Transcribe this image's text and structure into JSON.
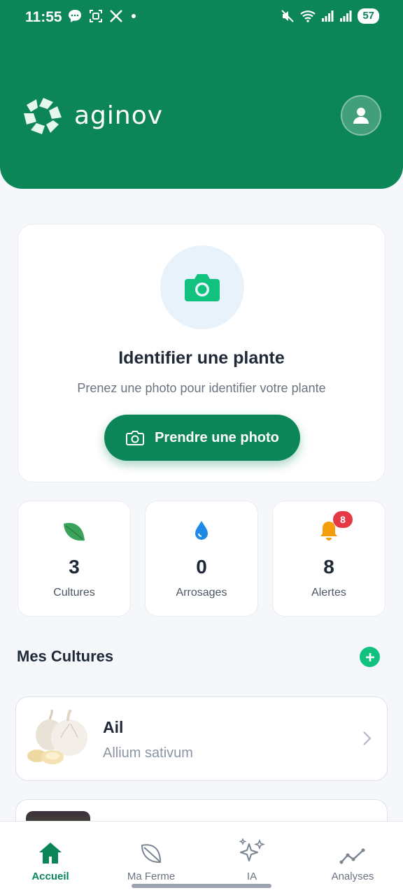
{
  "status_bar": {
    "time": "11:55",
    "battery": "57",
    "icons_left": [
      "chat-bubble-icon",
      "screenshot-icon",
      "x-logo-icon",
      "dot-icon"
    ],
    "icons_right": [
      "mute-icon",
      "wifi-icon",
      "signal-icon",
      "signal-icon"
    ]
  },
  "header": {
    "brand": "aginov",
    "bg_color": "#0c8558"
  },
  "identify": {
    "title": "Identifier une plante",
    "subtitle": "Prenez une photo pour identifier votre plante",
    "button_label": "Prendre une photo"
  },
  "stats": [
    {
      "icon": "leaf-icon",
      "value": "3",
      "label": "Cultures",
      "color": "#3aa35a"
    },
    {
      "icon": "water-drop-icon",
      "value": "0",
      "label": "Arrosages",
      "color": "#1e88e5"
    },
    {
      "icon": "bell-icon",
      "value": "8",
      "label": "Alertes",
      "color": "#f59e0b",
      "badge": "8"
    }
  ],
  "cultures": {
    "title": "Mes Cultures",
    "items": [
      {
        "name": "Ail",
        "latin": "Allium sativum"
      }
    ]
  },
  "bottom_nav": [
    {
      "label": "Accueil",
      "icon": "home-icon",
      "active": true
    },
    {
      "label": "Ma Ferme",
      "icon": "leaf-outline-icon",
      "active": false
    },
    {
      "label": "IA",
      "icon": "sparkles-icon",
      "active": false
    },
    {
      "label": "Analyses",
      "icon": "trend-line-icon",
      "active": false
    }
  ],
  "accent_color": "#10c27d"
}
